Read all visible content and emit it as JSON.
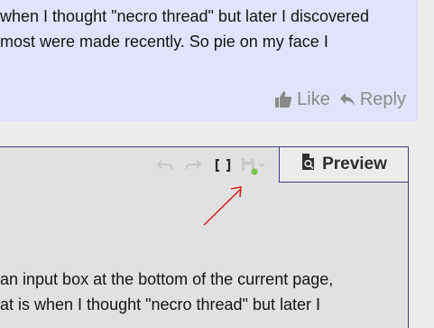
{
  "post": {
    "lines": [
      "when I thought \"necro thread\" but later I discovered",
      "most were made recently. So pie on my face I"
    ],
    "like_label": "Like",
    "reply_label": "Reply"
  },
  "editor": {
    "preview_label": "Preview",
    "body_lines": [
      "an input box at the bottom of the current page,",
      "at is when I thought \"necro thread\" but later I"
    ],
    "drafts_status_color": "#7cc242"
  },
  "annotation": {
    "arrow_color": "#e0191d"
  }
}
